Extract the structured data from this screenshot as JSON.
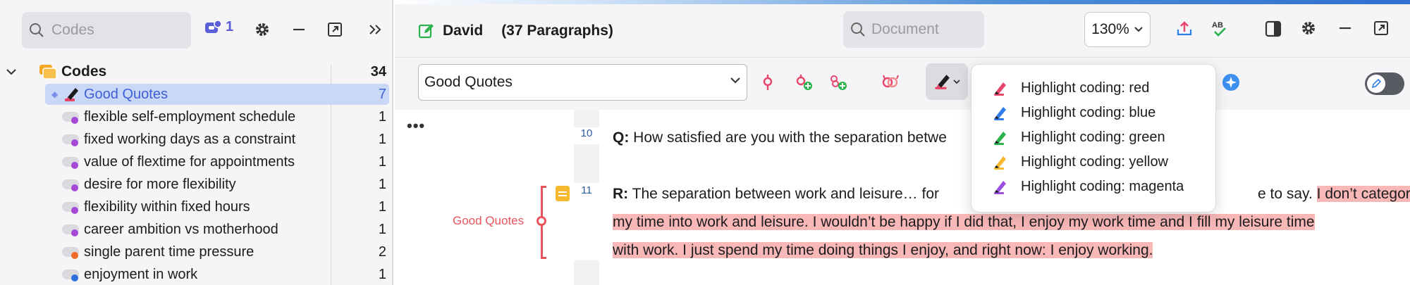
{
  "left_panel": {
    "search_placeholder": "Codes",
    "filter_count": "1",
    "tree": {
      "root": {
        "label": "Codes",
        "count": "34"
      },
      "items": [
        {
          "label": "Good Quotes",
          "count": "7",
          "color": "#e8545b",
          "selected": true
        },
        {
          "label": "flexible self-employment schedule",
          "count": "1",
          "color": "#a347d6"
        },
        {
          "label": "fixed working days as a constraint",
          "count": "1",
          "color": "#a347d6"
        },
        {
          "label": "value of flextime for appointments",
          "count": "1",
          "color": "#a347d6"
        },
        {
          "label": "desire for more flexibility",
          "count": "1",
          "color": "#a347d6"
        },
        {
          "label": "flexibility within fixed hours",
          "count": "1",
          "color": "#a347d6"
        },
        {
          "label": "career ambition vs motherhood",
          "count": "1",
          "color": "#a347d6"
        },
        {
          "label": "single parent time pressure",
          "count": "2",
          "color": "#f06a2a"
        },
        {
          "label": "enjoyment in work",
          "count": "1",
          "color": "#2f6fe0"
        }
      ]
    }
  },
  "document": {
    "name": "David",
    "paragraphs": "(37 Paragraphs)",
    "search_placeholder": "Document",
    "zoom": "130%",
    "code_select": "Good Quotes",
    "paragraph_10": {
      "number": "10",
      "prefix": "Q:",
      "text": " How satisfied are you with the separation betwe"
    },
    "paragraph_11": {
      "number": "11",
      "prefix": "R:",
      "line1_plain": " The separation between work and leisure… for",
      "line1_tail_plain": "e to say. ",
      "line1_hl": "I don’t categorize",
      "line2_hl": "my time into work and leisure. I wouldn’t be happy if I did that, I enjoy my work time and I fill my leisure time",
      "line3_hl": "with work. I just spend my time doing things I enjoy, and right now: I enjoy working."
    },
    "coding_label": "Good Quotes"
  },
  "highlight_menu": {
    "items": [
      {
        "label": "Highlight coding: red",
        "color": "#e8456a"
      },
      {
        "label": "Highlight coding: blue",
        "color": "#2f7be8"
      },
      {
        "label": "Highlight coding: green",
        "color": "#2bb24c"
      },
      {
        "label": "Highlight coding: yellow",
        "color": "#f5b82e"
      },
      {
        "label": "Highlight coding: magenta",
        "color": "#9b4fe0"
      }
    ]
  }
}
